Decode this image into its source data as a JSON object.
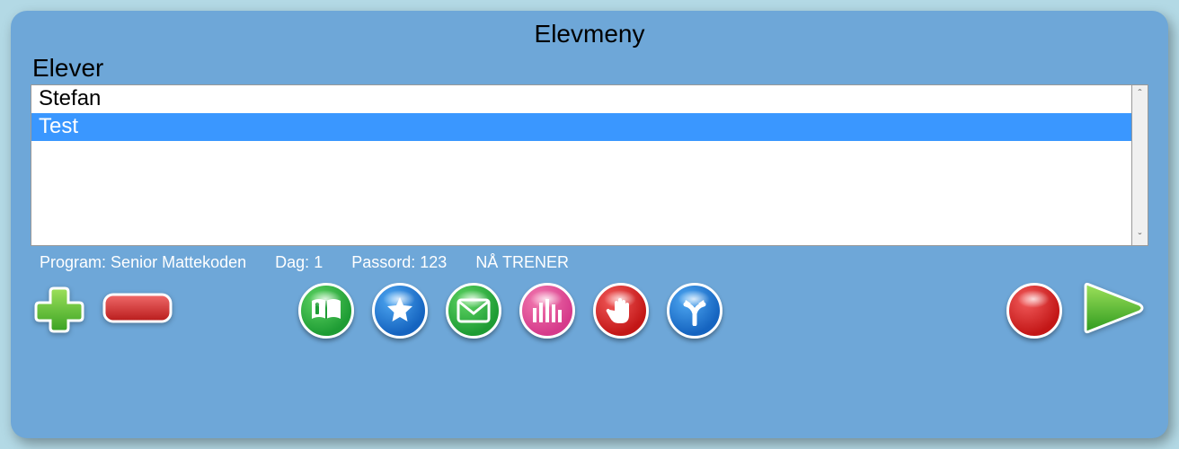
{
  "title": "Elevmeny",
  "subtitle": "Elever",
  "students": [
    "Stefan",
    "Test"
  ],
  "selected_index": 1,
  "status": {
    "program_label": "Program:",
    "program_value": "Senior Mattekoden",
    "day_label": "Dag:",
    "day_value": "1",
    "password_label": "Passord:",
    "password_value": "123",
    "training_label": "NÅ TRENER"
  },
  "icons": {
    "add": "add-button",
    "remove": "remove-button",
    "book": "book-button",
    "star": "star-button",
    "mail": "mail-button",
    "stats": "stats-button",
    "hand": "hand-button",
    "branch": "branch-button",
    "record": "record-button",
    "play": "play-button"
  }
}
